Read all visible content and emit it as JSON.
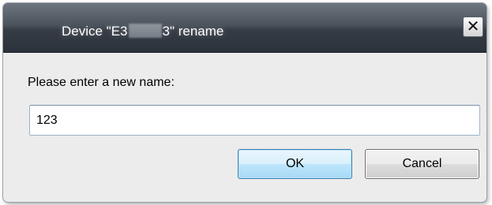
{
  "dialog": {
    "title_prefix": "Device \"E3",
    "title_suffix": "3\" rename",
    "close_label": "✕"
  },
  "form": {
    "prompt": "Please enter a new name:",
    "name_value": "123"
  },
  "buttons": {
    "ok_label": "OK",
    "cancel_label": "Cancel"
  }
}
